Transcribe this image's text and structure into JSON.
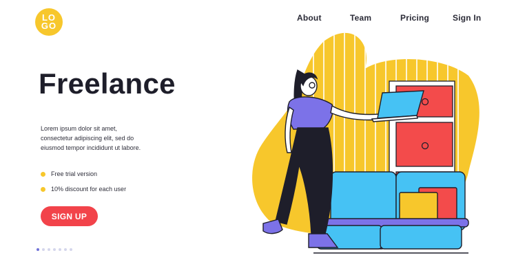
{
  "logo": {
    "text": "LOGO",
    "color": "#f7c72c"
  },
  "nav": {
    "items": [
      {
        "label": "About"
      },
      {
        "label": "Team"
      },
      {
        "label": "Pricing"
      },
      {
        "label": "Sign In"
      }
    ]
  },
  "hero": {
    "title": "Freelance",
    "description": "Lorem ipsum dolor sit amet, consectetur adipiscing elit, sed do eiusmod tempor incididunt ut labore.",
    "features": [
      {
        "label": "Free trial version",
        "icon": "yellow-dot-icon"
      },
      {
        "label": "10% discount for each user",
        "icon": "yellow-dot-icon"
      }
    ],
    "cta_label": "SIGN UP"
  },
  "pager": {
    "count": 7,
    "active_index": 0
  },
  "colors": {
    "accent_yellow": "#f7c72c",
    "cta_red": "#f2434a",
    "purple": "#7c72e8",
    "sofa_blue": "#46c2f4",
    "cabinet_red": "#f34b4b",
    "text_dark": "#1e1e2a"
  }
}
